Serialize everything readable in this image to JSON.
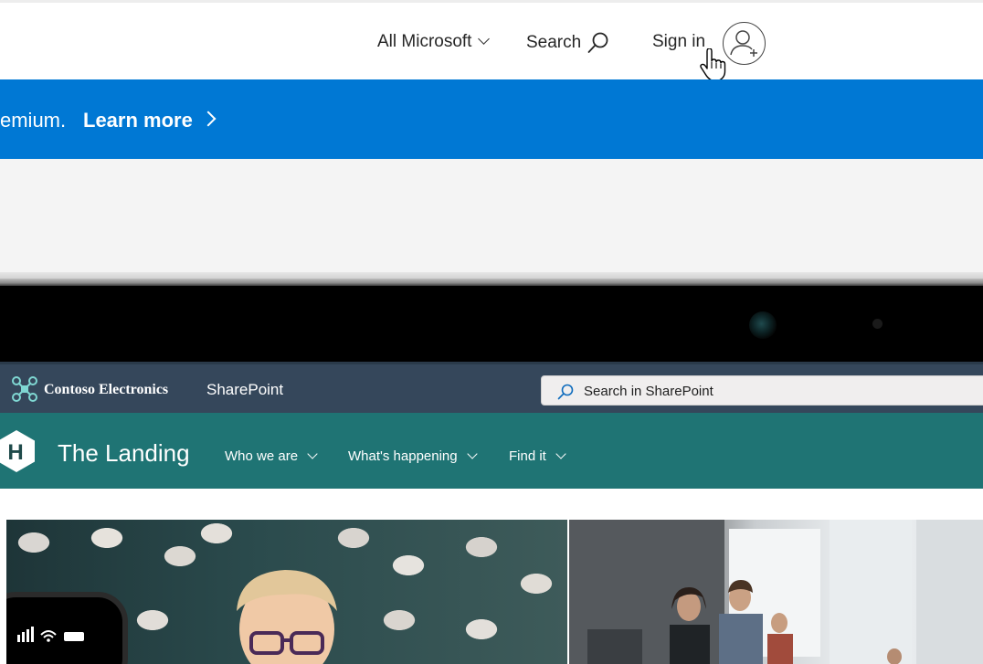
{
  "ms_header": {
    "all_microsoft": "All Microsoft",
    "search": "Search",
    "sign_in": "Sign in"
  },
  "banner": {
    "text": "emium.",
    "link": "Learn more",
    "color": "#0078d4"
  },
  "sharepoint": {
    "org_name": "Contoso Electronics",
    "app_name": "SharePoint",
    "search_placeholder": "Search in SharePoint",
    "suite_bar_color": "#35475b"
  },
  "site": {
    "logo_letter": "H",
    "title": "The Landing",
    "nav": [
      "Who we are",
      "What's happening",
      "Find it"
    ],
    "header_color": "#1f7474"
  },
  "icons": {
    "search": "search-icon",
    "avatar": "add-user-icon",
    "cursor": "hand-pointer-icon",
    "org_logo": "drone-logo-icon",
    "chevron": "chevron-down-icon"
  }
}
